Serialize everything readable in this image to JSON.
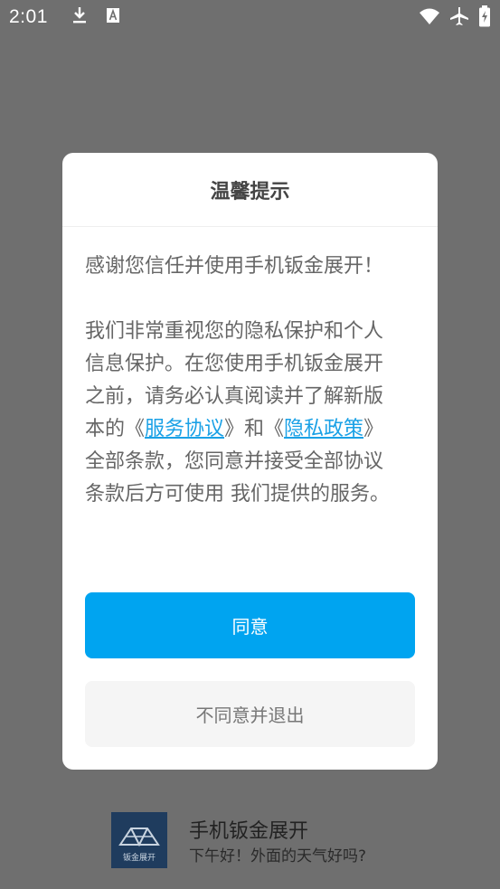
{
  "status_bar": {
    "time": "2:01",
    "left_icons": [
      "download-icon",
      "a-badge-icon"
    ],
    "right_icons": [
      "wifi-icon",
      "airplane-icon",
      "battery-charging-icon"
    ]
  },
  "dialog": {
    "title": "温馨提示",
    "para1": "感谢您信任并使用手机钣金展开！",
    "para2": {
      "before": "我们非常重视您的隐私保护和个人信息保护。在您使用手机钣金展开之前，请务必认真阅读并了解新版本的《",
      "link1": "服务协议",
      "middle": "》和《",
      "link2": "隐私政策",
      "after": "》全部条款，您同意并接受全部协议条款后方可使用 我们提供的服务。"
    },
    "agree_label": "同意",
    "disagree_label": "不同意并退出"
  },
  "background_app": {
    "logo_text": "钣金展开",
    "name": "手机钣金展开",
    "greeting": "下午好！外面的天气好吗?"
  },
  "colors": {
    "accent": "#00a4f0",
    "link": "#1aa1e6",
    "overlay": "#6f6f6f"
  }
}
